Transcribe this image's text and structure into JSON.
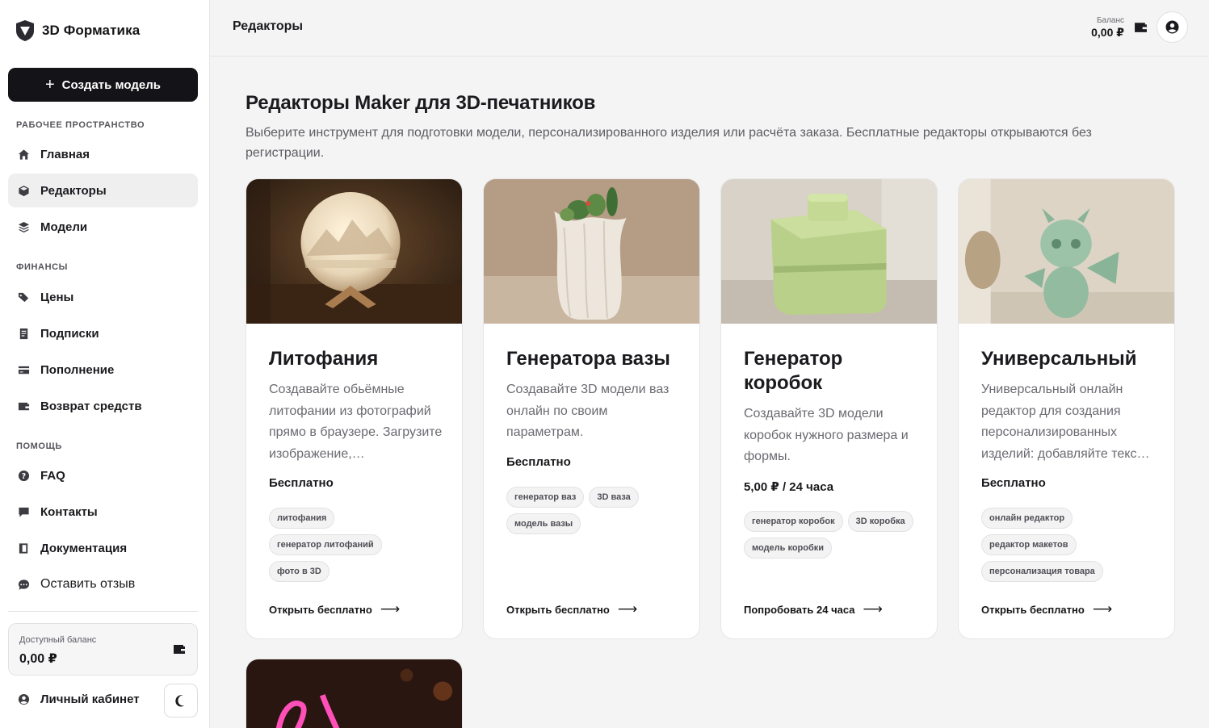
{
  "brand": {
    "name": "3D Форматика"
  },
  "sidebar": {
    "create_label": "Создать модель",
    "sections": {
      "workspace": "РАБОЧЕЕ ПРОСТРАНСТВО",
      "finance": "ФИНАНСЫ",
      "help": "ПОМОЩЬ"
    },
    "items": [
      {
        "label": "Главная",
        "icon": "home-icon"
      },
      {
        "label": "Редакторы",
        "icon": "cube-icon",
        "active": true
      },
      {
        "label": "Модели",
        "icon": "layers-icon"
      },
      {
        "label": "Цены",
        "icon": "tags-icon"
      },
      {
        "label": "Подписки",
        "icon": "receipt-icon"
      },
      {
        "label": "Пополнение",
        "icon": "credit-card-icon"
      },
      {
        "label": "Возврат средств",
        "icon": "wallet-icon"
      },
      {
        "label": "FAQ",
        "icon": "question-circle-icon"
      },
      {
        "label": "Контакты",
        "icon": "chat-bubble-icon"
      },
      {
        "label": "Документация",
        "icon": "book-icon"
      },
      {
        "label": "Оставить отзыв",
        "icon": "feedback-icon"
      }
    ],
    "balance": {
      "label": "Доступный баланс",
      "value": "0,00 ₽"
    },
    "account_label": "Личный кабинет"
  },
  "topbar": {
    "title": "Редакторы",
    "balance_label": "Баланс",
    "balance_value": "0,00 ₽"
  },
  "main": {
    "title": "Редакторы Maker для 3D-печатников",
    "description": "Выберите инструмент для подготовки модели, персонализированного изделия или расчёта заказа. Бесплатные редакторы открываются без регистрации.",
    "cards": [
      {
        "title": "Литофания",
        "description": "Создавайте обьёмные литофании из фотографий прямо в браузере. Загрузите изображение,…",
        "price": "Бесплатно",
        "tags": [
          "литофания",
          "генератор литофаний",
          "фото в 3D"
        ],
        "cta": "Открыть бесплатно"
      },
      {
        "title": "Генератора вазы",
        "description": "Создавайте 3D модели ваз онлайн по своим параметрам.",
        "price": "Бесплатно",
        "tags": [
          "генератор ваз",
          "3D ваза",
          "модель вазы"
        ],
        "cta": "Открыть бесплатно"
      },
      {
        "title": "Генератор коробок",
        "description": "Создавайте 3D модели коробок нужного размера и формы.",
        "price": "5,00 ₽ / 24 часа",
        "tags": [
          "генератор коробок",
          "3D коробка",
          "модель коробки"
        ],
        "cta": "Попробовать 24 часа"
      },
      {
        "title": "Универсальный",
        "description": "Универсальный онлайн редактор для создания персонализированных изделий: добавляйте текс…",
        "price": "Бесплатно",
        "tags": [
          "онлайн редактор",
          "редактор макетов",
          "персонализация товара"
        ],
        "cta": "Открыть бесплатно"
      }
    ]
  },
  "colors": {
    "accent_dark": "#141418",
    "background": "#f4f4f4",
    "card_bg": "#ffffff",
    "muted_text": "#6a6a71"
  }
}
